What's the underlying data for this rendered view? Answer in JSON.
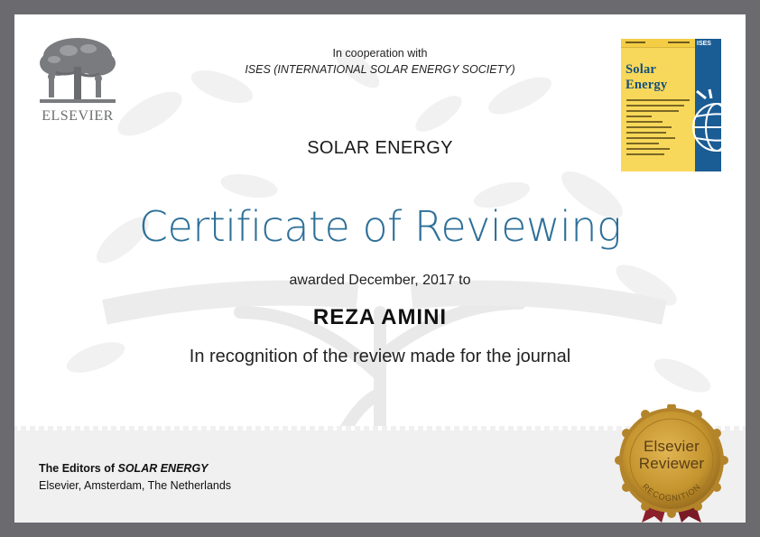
{
  "publisher": {
    "name": "ELSEVIER",
    "logo_icon": "elsevier-tree-icon"
  },
  "cooperation": {
    "line1": "In cooperation with",
    "organization": "ISES (INTERNATIONAL SOLAR ENERGY SOCIETY)"
  },
  "journal": {
    "name": "SOLAR ENERGY"
  },
  "cover": {
    "title_line1": "Solar",
    "title_line2": "Energy",
    "badge": "ISES"
  },
  "certificate": {
    "title": "Certificate of Reviewing",
    "awarded": "awarded December, 2017 to",
    "recipient": "REZA AMINI",
    "recognition": "In recognition of the review made for the journal"
  },
  "footer": {
    "editors_prefix": "The Editors of ",
    "editors_journal": "SOLAR ENERGY",
    "location": "Elsevier, Amsterdam, The Netherlands"
  },
  "seal": {
    "line1": "Elsevier",
    "line2": "Reviewer",
    "ribbon": "RECOGNITION"
  },
  "colors": {
    "title_blue": "#2d6f98",
    "border_gray": "#6b6a6f",
    "seal_gold": "#c4942e",
    "ribbon_red": "#8c1f2c",
    "cover_yellow": "#f8d85a",
    "cover_blue": "#1a5c94"
  }
}
